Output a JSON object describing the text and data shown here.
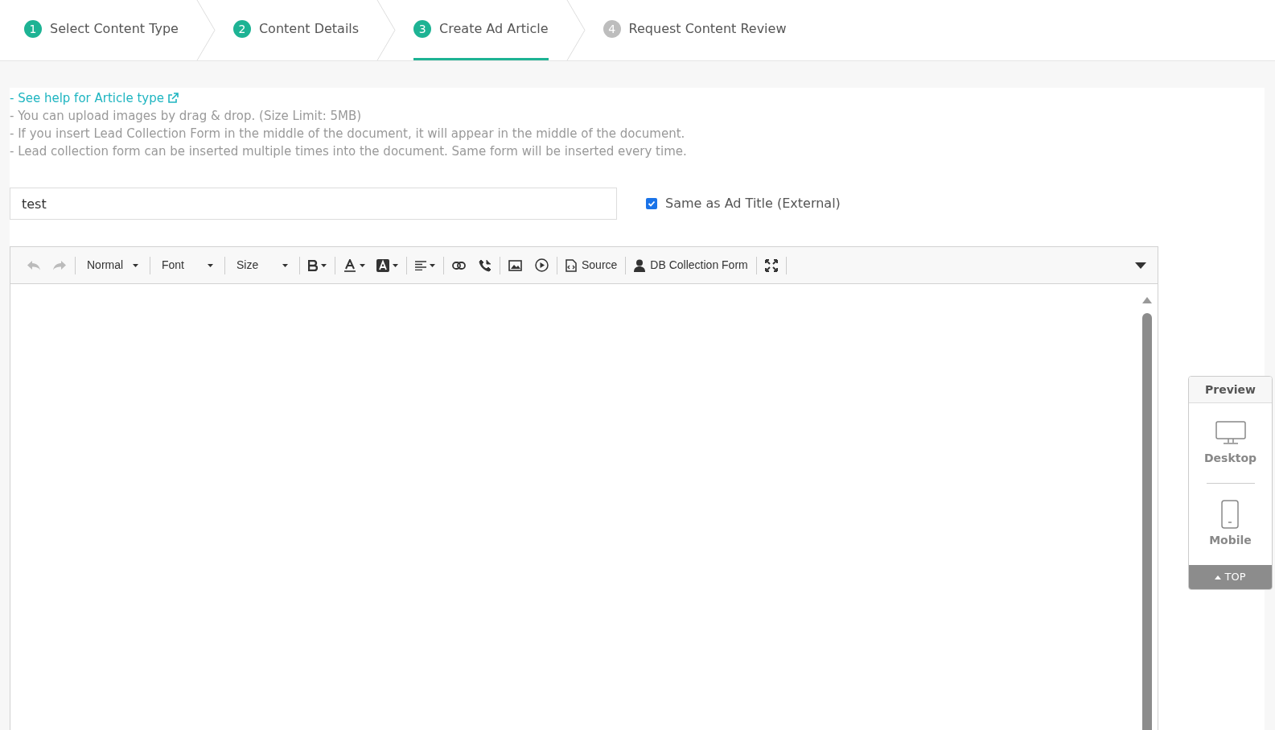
{
  "steps": [
    {
      "number": "1",
      "label": "Select Content Type",
      "completed": true,
      "selected": false
    },
    {
      "number": "2",
      "label": "Content Details",
      "completed": true,
      "selected": false
    },
    {
      "number": "3",
      "label": "Create Ad Article",
      "completed": true,
      "selected": true
    },
    {
      "number": "4",
      "label": "Request Content Review",
      "completed": false,
      "selected": false
    }
  ],
  "help": {
    "link": "- See help for Article type",
    "notes": [
      "- You can upload images by drag & drop. (Size Limit: 5MB)",
      "- If you insert Lead Collection Form in the middle of the document, it will appear in the middle of the document.",
      "- Lead collection form can be inserted multiple times into the document. Same form will be inserted every time."
    ]
  },
  "title_field": {
    "value": "test"
  },
  "same_as_title": {
    "label": "Same as Ad Title (External)",
    "checked": true
  },
  "toolbar": {
    "undo": {
      "disabled": true
    },
    "redo": {
      "disabled": true
    },
    "dropdowns": [
      "Normal",
      "Font",
      "Size"
    ],
    "source_label": "Source",
    "form_label": "DB Collection Form"
  },
  "preview": {
    "title": "Preview",
    "desktop": "Desktop",
    "mobile": "Mobile",
    "top": "TOP"
  }
}
